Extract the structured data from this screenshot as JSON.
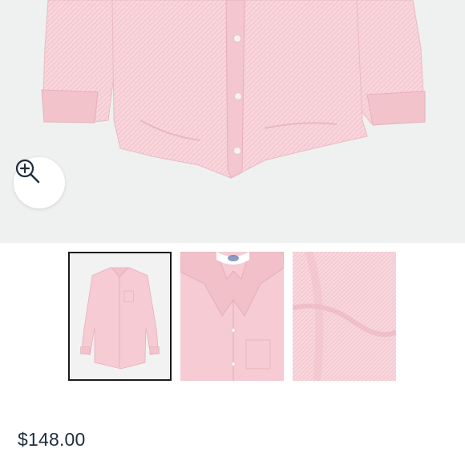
{
  "product": {
    "price": "$148.00",
    "shirt_color": "#f6cbd3",
    "shirt_shade": "#eab7c1",
    "background_color": "#eef1ef"
  },
  "gallery": {
    "zoom_icon": "zoom-in-icon",
    "selected_index": 0,
    "thumbnails": [
      {
        "view": "full-front"
      },
      {
        "view": "collar-closeup"
      },
      {
        "view": "fabric-texture"
      }
    ]
  }
}
